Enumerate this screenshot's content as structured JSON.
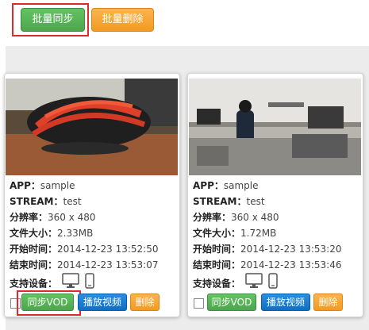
{
  "toolbar": {
    "batch_sync": "批量同步",
    "batch_delete": "批量删除"
  },
  "cards": [
    {
      "app_label": "APP：",
      "app": "sample",
      "stream_label": "STREAM：",
      "stream": "test",
      "res_label": "分辨率：",
      "res": "360 x 480",
      "size_label": "文件大小：",
      "size": "2.33MB",
      "start_label": "开始时间：",
      "start": "2014-12-23 13:52:50",
      "end_label": "结束时间：",
      "end": "2014-12-23 13:53:07",
      "devices_label": "支持设备：",
      "devices": [
        "monitor-icon",
        "phone-icon"
      ],
      "sync_btn": "同步VOD",
      "play_btn": "播放视频",
      "del_btn": "删除"
    },
    {
      "app_label": "APP：",
      "app": "sample",
      "stream_label": "STREAM：",
      "stream": "test",
      "res_label": "分辨率：",
      "res": "360 x 480",
      "size_label": "文件大小：",
      "size": "1.72MB",
      "start_label": "开始时间：",
      "start": "2014-12-23 13:53:20",
      "end_label": "结束时间：",
      "end": "2014-12-23 13:53:46",
      "devices_label": "支持设备：",
      "devices": [
        "monitor-icon",
        "phone-icon"
      ],
      "sync_btn": "同步VOD",
      "play_btn": "播放视频",
      "del_btn": "删除"
    }
  ],
  "colors": {
    "green": "#5cb85c",
    "orange": "#f5a623",
    "blue": "#1a7fd6",
    "highlight": "#e02a2a"
  }
}
